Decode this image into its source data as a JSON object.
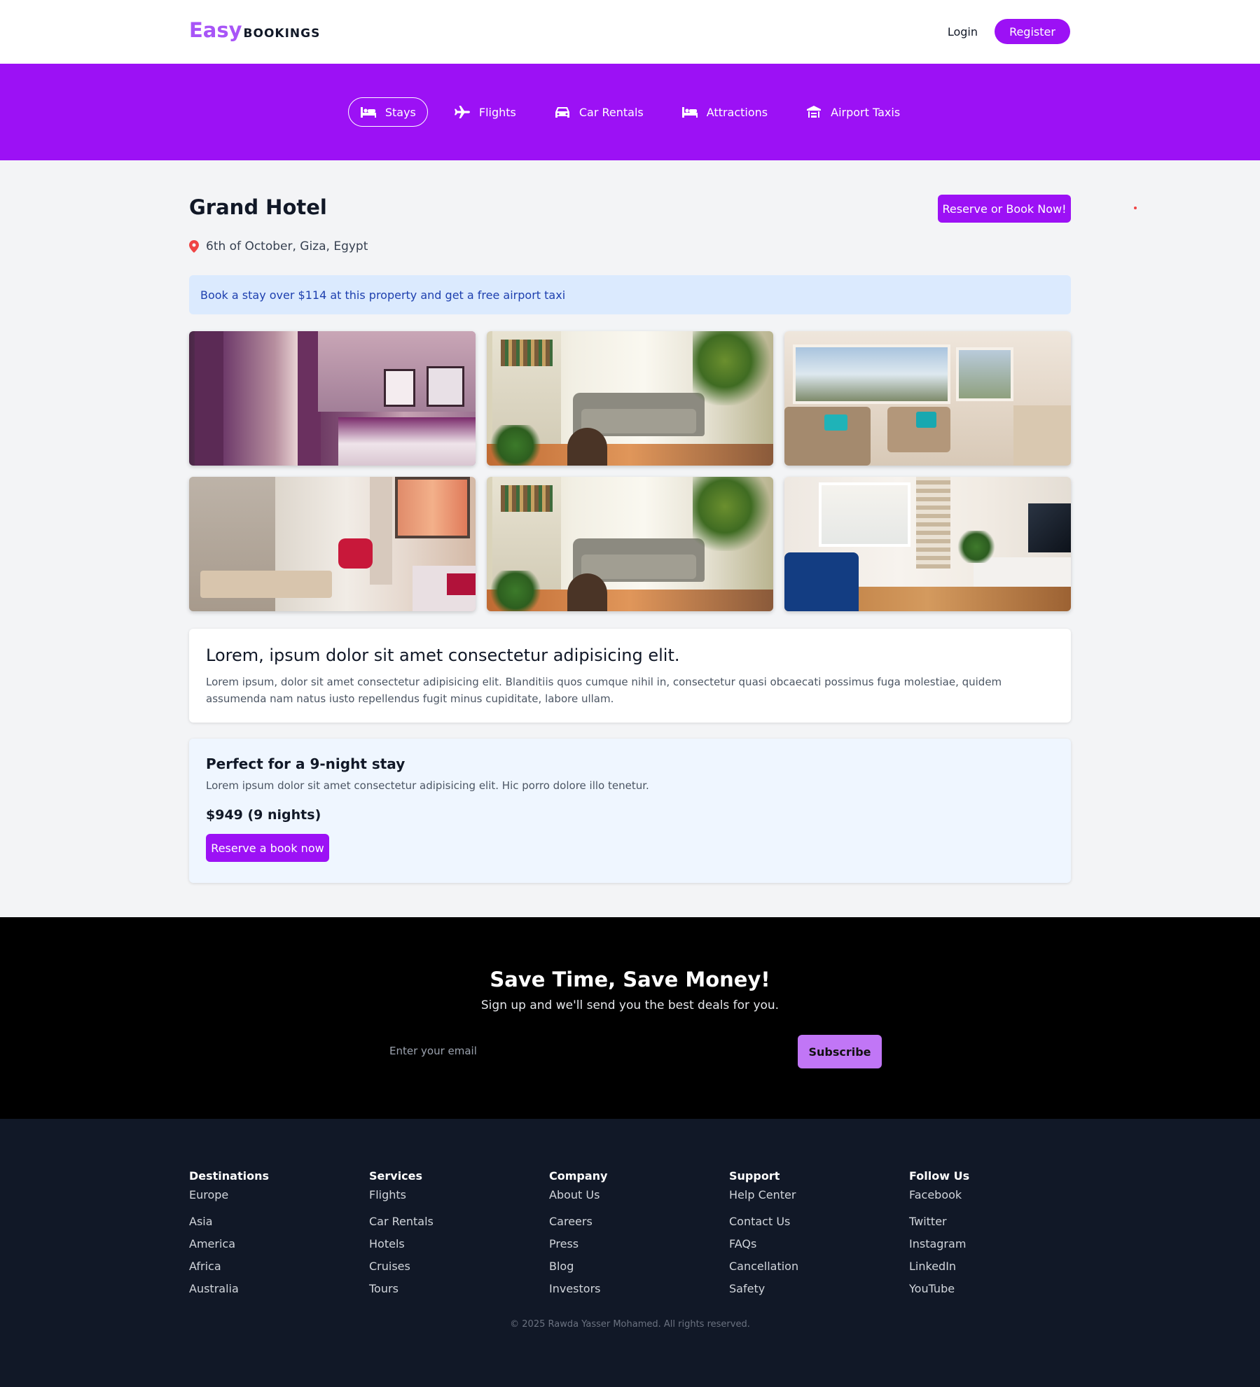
{
  "header": {
    "logo_primary": "Easy",
    "logo_secondary": "BOOKINGS",
    "login_label": "Login",
    "register_label": "Register"
  },
  "services_nav": {
    "items": [
      {
        "label": "Stays",
        "icon": "bed-icon",
        "active": true
      },
      {
        "label": "Flights",
        "icon": "plane-icon",
        "active": false
      },
      {
        "label": "Car Rentals",
        "icon": "car-icon",
        "active": false
      },
      {
        "label": "Attractions",
        "icon": "bed-icon",
        "active": false
      },
      {
        "label": "Airport Taxis",
        "icon": "taxi-icon",
        "active": false
      }
    ]
  },
  "hotel": {
    "name": "Grand Hotel",
    "reserve_label": "Reserve or Book Now!",
    "location": "6th of October, Giza, Egypt",
    "promo": "Book a stay over $114 at this property and get a free airport taxi",
    "photos": [
      "purple-bedroom",
      "living-room-plants",
      "bright-living-room",
      "apartment-kitchen",
      "living-room-plants",
      "white-room-blue-sofa"
    ]
  },
  "description": {
    "title": "Lorem, ipsum dolor sit amet consectetur adipisicing elit.",
    "text": "Lorem ipsum, dolor sit amet consectetur adipisicing elit. Blanditiis quos cumque nihil in, consectetur quasi obcaecati possimus fuga molestiae, quidem assumenda nam natus iusto repellendus fugit minus cupiditate, labore ullam."
  },
  "stay": {
    "title": "Perfect for a 9-night stay",
    "text": "Lorem ipsum dolor sit amet consectetur adipisicing elit. Hic porro dolore illo tenetur.",
    "price": "$949 (9 nights)",
    "button_label": "Reserve a book now"
  },
  "newsletter": {
    "title": "Save Time, Save Money!",
    "subtitle": "Sign up and we'll send you the best deals for you.",
    "email_placeholder": "Enter your email",
    "subscribe_label": "Subscribe"
  },
  "footer": {
    "columns": [
      {
        "title": "Destinations",
        "links": [
          "Europe",
          "Asia",
          "America",
          "Africa",
          "Australia"
        ]
      },
      {
        "title": "Services",
        "links": [
          "Flights",
          "Car Rentals",
          "Hotels",
          "Cruises",
          "Tours"
        ]
      },
      {
        "title": "Company",
        "links": [
          "About Us",
          "Careers",
          "Press",
          "Blog",
          "Investors"
        ]
      },
      {
        "title": "Support",
        "links": [
          "Help Center",
          "Contact Us",
          "FAQs",
          "Cancellation",
          "Safety"
        ]
      },
      {
        "title": "Follow Us",
        "links": [
          "Facebook",
          "Twitter",
          "Instagram",
          "LinkedIn",
          "YouTube"
        ]
      }
    ],
    "copyright": "© 2025 Rawda Yasser Mohamed. All rights reserved."
  },
  "colors": {
    "brand_purple": "#9c11f5",
    "logo_purple": "#a855f7",
    "promo_bg": "#dbeafe",
    "footer_bg": "#111827"
  }
}
